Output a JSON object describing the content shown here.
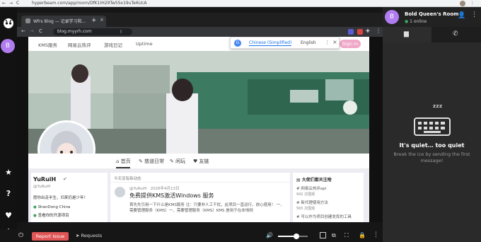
{
  "host": {
    "url": "hyperbeam.com/app/room/DfK1IH29Tw5Sx19uTe6UcA"
  },
  "inner_browser": {
    "tab_title": "Wfrs Blog — 记录学习和…",
    "url": "blog.myyrh.com",
    "translate": {
      "option1": "Chinese (Simplified)",
      "option2": "English"
    }
  },
  "blog": {
    "nav": [
      "KMS服务",
      "网易云热评",
      "游戏日记",
      "Uptime"
    ],
    "signin": "Sign in",
    "tabs": [
      "首页",
      "慈道日常",
      "闲玩",
      "友链"
    ],
    "author": {
      "name": "YuRuiH",
      "handle": "@YuRuiH",
      "bio": "愿你出走半生，归来仍是少年！",
      "location": "ShanDong China",
      "extra": "查看你的开源项目"
    },
    "feed_header": "今天没有新动态",
    "post": {
      "meta": "@YuRuiH · 2026年4月13日",
      "title": "免费提供KMS激活Windows 服务",
      "body1": "首先先引用一下什么是KMS服务 注：只要非人工干扰，此项目一直运行，放心使用！ 一、需要管理服务（KMS）一、需要管理服务（KMS）KMS 是用于在本地网"
    },
    "side": {
      "title": "大佬们都关注啥",
      "items": [
        {
          "name": "# 网易云热评api",
          "count": "942 次围观"
        },
        {
          "name": "# 新代理使用方法",
          "count": "565 次围观"
        },
        {
          "name": "# 可以作为项目创建发挥的工具",
          "count": ""
        }
      ]
    }
  },
  "bottom": {
    "report": "Report Issue",
    "requests": "Requests"
  },
  "room": {
    "avatar": "B",
    "title": "Bold Queen's Room",
    "online": "1 online",
    "empty_title": "It's quiet… too quiet",
    "empty_text": "Break the ice by sending the first message!",
    "zzz": "z z z"
  },
  "rail": {
    "avatar": "B"
  },
  "colors": {
    "accent": "#b07cf0",
    "report": "#e05555",
    "online": "#3ba55d"
  }
}
